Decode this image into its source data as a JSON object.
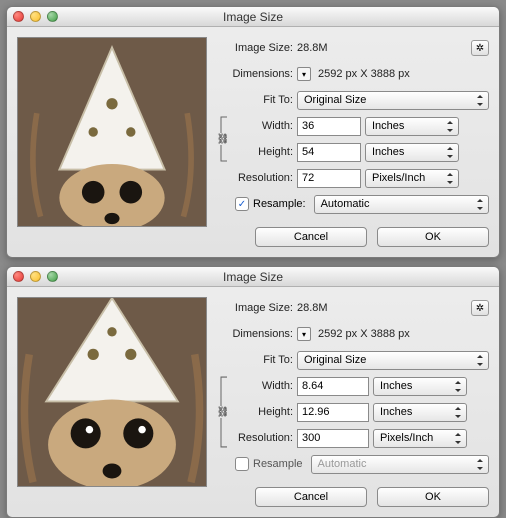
{
  "title": "Image Size",
  "labels": {
    "imageSize": "Image Size:",
    "dimensions": "Dimensions:",
    "fitTo": "Fit To:",
    "width": "Width:",
    "height": "Height:",
    "resolution": "Resolution:",
    "resample": "Resample:",
    "cancel": "Cancel",
    "ok": "OK"
  },
  "top": {
    "imageSize": "28.8M",
    "dimPx": "2592 px  X  3888 px",
    "fitTo": "Original Size",
    "width": "36",
    "widthUnit": "Inches",
    "height": "54",
    "heightUnit": "Inches",
    "resolution": "72",
    "resUnit": "Pixels/Inch",
    "resampleChecked": true,
    "resampleMode": "Automatic"
  },
  "bottom": {
    "imageSize": "28.8M",
    "dimPx": "2592 px  X  3888 px",
    "fitTo": "Original Size",
    "width": "8.64",
    "widthUnit": "Inches",
    "height": "12.96",
    "heightUnit": "Inches",
    "resolution": "300",
    "resUnit": "Pixels/Inch",
    "resampleChecked": false,
    "resampleMode": "Automatic"
  }
}
